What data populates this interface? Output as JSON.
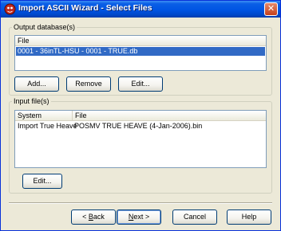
{
  "window": {
    "title": "Import ASCII Wizard - Select Files",
    "close_glyph": "✕"
  },
  "output_group": {
    "label": "Output database(s)",
    "columns": [
      "File"
    ],
    "rows": [
      {
        "file": "0001 - 36inTL-HSU - 0001 - TRUE.db",
        "selected": true
      }
    ],
    "buttons": {
      "add": "Add...",
      "remove": "Remove",
      "edit": "Edit..."
    }
  },
  "input_group": {
    "label": "Input file(s)",
    "columns": [
      "System",
      "File"
    ],
    "rows": [
      {
        "system": "Import True Heave",
        "file": "POSMV TRUE HEAVE (4-Jan-2006).bin"
      }
    ],
    "buttons": {
      "edit": "Edit..."
    }
  },
  "footer": {
    "back_mnemonic": "B",
    "back_rest": "ack",
    "back_prefix": "< ",
    "next_mnemonic": "N",
    "next_rest": "ext >",
    "cancel": "Cancel",
    "help": "Help"
  },
  "colors": {
    "titlebar": "#0054e3",
    "selection": "#316ac5",
    "dialog_bg": "#ece9d8",
    "button_border": "#003c74"
  },
  "icons": {
    "title_icon": "red-wizard-app-icon",
    "close_icon": "close-x-icon"
  }
}
